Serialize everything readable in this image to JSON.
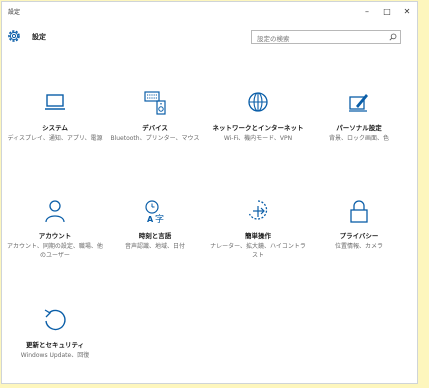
{
  "window": {
    "title": "設定",
    "controls": {
      "minimize": "–",
      "maximize": "□",
      "close": "✕"
    }
  },
  "header": {
    "title": "設定",
    "search_placeholder": "設定の検索"
  },
  "tiles": [
    {
      "id": "system",
      "icon": "monitor-icon",
      "label": "システム",
      "desc": "ディスプレイ、通知、アプリ、電源"
    },
    {
      "id": "devices",
      "icon": "keyboard-speaker-icon",
      "label": "デバイス",
      "desc": "Bluetooth、プリンター、マウス"
    },
    {
      "id": "network",
      "icon": "globe-icon",
      "label": "ネットワークとインターネット",
      "desc": "Wi-Fi、機内モード、VPN"
    },
    {
      "id": "personalization",
      "icon": "paint-icon",
      "label": "パーソナル設定",
      "desc": "背景、ロック画面、色"
    },
    {
      "id": "accounts",
      "icon": "person-icon",
      "label": "アカウント",
      "desc": "アカウント、同期の設定、職場、他のユーザー"
    },
    {
      "id": "time-language",
      "icon": "time-language-icon",
      "label": "時刻と言語",
      "desc": "音声認識、地域、日付"
    },
    {
      "id": "ease-of-access",
      "icon": "ease-of-access-icon",
      "label": "簡単操作",
      "desc": "ナレーター、拡大鏡、ハイコントラスト"
    },
    {
      "id": "privacy",
      "icon": "lock-icon",
      "label": "プライバシー",
      "desc": "位置情報、カメラ"
    },
    {
      "id": "update-security",
      "icon": "refresh-icon",
      "label": "更新とセキュリティ",
      "desc": "Windows Update、回復"
    }
  ],
  "colors": {
    "accent": "#0a5ea8",
    "background": "#fdf6bd",
    "window": "#ffffff"
  }
}
